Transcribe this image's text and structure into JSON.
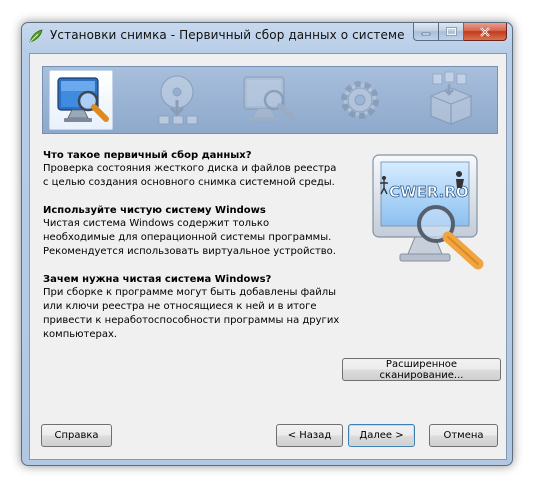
{
  "window": {
    "title": "Установки снимка - Первичный сбор данных о системе"
  },
  "icons": {
    "app": "app-leaf-icon",
    "steps": [
      "monitor-magnifier-icon",
      "disc-install-icon",
      "monitor-magnifier-icon",
      "gear-icon",
      "package-icon"
    ]
  },
  "sections": [
    {
      "title": "Что такое первичный сбор данных?",
      "text": "Проверка состояния жесткого диска и файлов реестра с целью создания основного снимка системной среды."
    },
    {
      "title": "Используйте чистую систему Windows",
      "text": "Чистая система Windows содержит только необходимые для операционной системы программы. Рекомендуется использовать виртуальное устройство."
    },
    {
      "title": "Зачем нужна чистая система Windows?",
      "text": "При сборке к программе могут быть добавлены файлы или ключи реестра не относящиеся к ней и в итоге привести к неработоспособности программы на других компьютерах."
    }
  ],
  "illustration": {
    "screen_text": "CWER.RO"
  },
  "buttons": {
    "advanced": "Расширенное сканирование...",
    "help": "Справка",
    "back": "< Назад",
    "next": "Далее >",
    "cancel": "Отмена"
  },
  "colors": {
    "accent": "#3c7fb1",
    "banner": "#9db6d8",
    "close": "#c23a1f"
  }
}
